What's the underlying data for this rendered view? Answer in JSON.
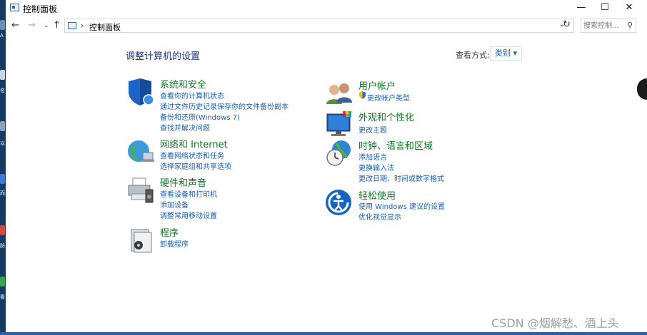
{
  "window": {
    "title": "控制面板",
    "minimize": "—",
    "maximize": "☐",
    "close": "✕"
  },
  "address": {
    "path": "控制面板",
    "search_placeholder": "搜索控制..."
  },
  "content": {
    "heading": "调整计算机的设置",
    "view_by_label": "查看方式:",
    "view_by_value": "类别 ▾"
  },
  "categories": [
    {
      "title": "系统和安全",
      "links": [
        "查看你的计算机状态",
        "通过文件历史记录保存你的文件备份副本",
        "备份和还原(Windows 7)",
        "查找并解决问题"
      ]
    },
    {
      "title": "网络和 Internet",
      "links": [
        "查看网络状态和任务",
        "选择家庭组和共享选项"
      ]
    },
    {
      "title": "硬件和声音",
      "links": [
        "查看设备和打印机",
        "添加设备",
        "调整常用移动设置"
      ]
    },
    {
      "title": "程序",
      "links": [
        "卸载程序"
      ]
    },
    {
      "title": "用户帐户",
      "links": [
        "更改帐户类型"
      ]
    },
    {
      "title": "外观和个性化",
      "links": [
        "更改主题"
      ]
    },
    {
      "title": "时钟、语言和区域",
      "links": [
        "添加语言",
        "更换输入法",
        "更改日期、时间或数字格式"
      ]
    },
    {
      "title": "轻松使用",
      "links": [
        "使用 Windows 建议的设置",
        "优化视觉显示"
      ]
    }
  ],
  "watermark": "CSDN @烟解愁、酒上头",
  "desktop_labels": [
    "A",
    "名",
    "以",
    "而",
    "防",
    "看"
  ]
}
